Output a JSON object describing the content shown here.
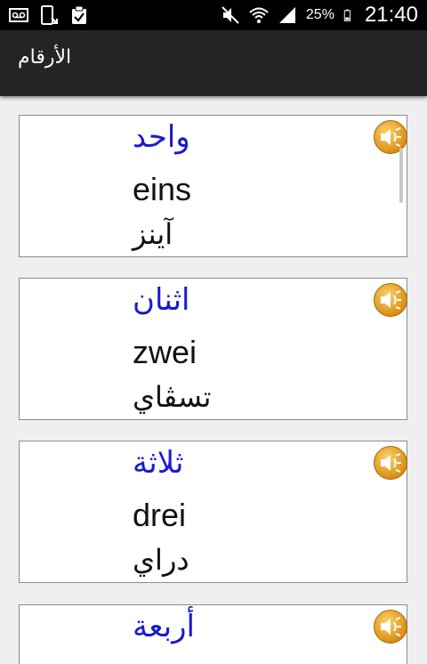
{
  "status_bar": {
    "battery": "25%",
    "time": "21:40"
  },
  "app_bar": {
    "title": "الأرقام"
  },
  "cards": [
    {
      "arabic": "واحد",
      "german": "eins",
      "transliteration": "آينز"
    },
    {
      "arabic": "اثنان",
      "german": "zwei",
      "transliteration": "تسڤاي"
    },
    {
      "arabic": "ثلاثة",
      "german": "drei",
      "transliteration": "دراي"
    },
    {
      "arabic": "أربعة",
      "german": "",
      "transliteration": ""
    }
  ],
  "colors": {
    "arabic_text": "#1a1ad0",
    "speaker_orange": "#e8a21a",
    "app_bar": "#242424"
  },
  "icons": {
    "speaker": "speaker-icon"
  }
}
